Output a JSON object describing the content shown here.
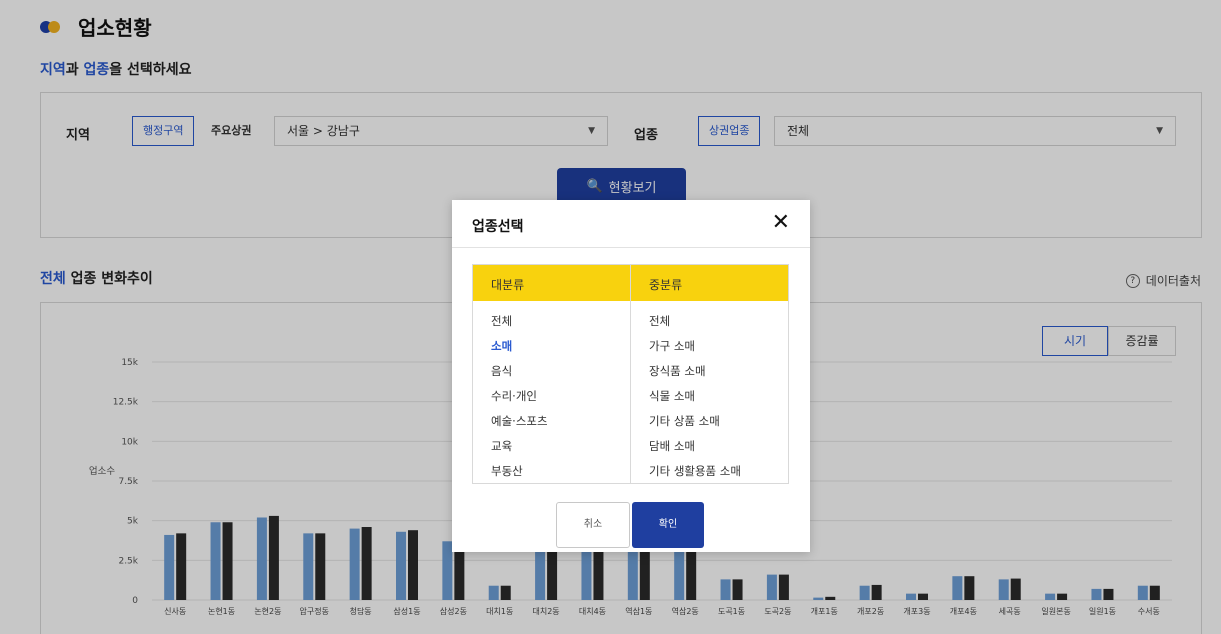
{
  "page": {
    "title": "업소현황",
    "instruction_part1": "지역",
    "instruction_part2": "과 ",
    "instruction_part3": "업종",
    "instruction_part4": "을 선택하세요"
  },
  "filter": {
    "region_label": "지역",
    "region_tab_admin": "행정구역",
    "region_tab_main": "주요상권",
    "region_value": "서울 > 강남구",
    "industry_label": "업종",
    "industry_tab": "상권업종",
    "industry_value": "전체",
    "view_button": "현황보기"
  },
  "section": {
    "title_highlight": "전체",
    "title_rest": " 업종 변화추이",
    "export_label": "데이터출처",
    "toggle_count": "시기",
    "toggle_rate": "증감률"
  },
  "chart_data": {
    "type": "bar",
    "ylabel": "업소수",
    "yticks": [
      "0",
      "2.5k",
      "5k",
      "7.5k",
      "10k",
      "12.5k",
      "15k"
    ],
    "ylim": [
      0,
      15000
    ],
    "categories": [
      "신사동",
      "논현1동",
      "논현2동",
      "압구정동",
      "청담동",
      "삼성1동",
      "삼성2동",
      "대치1동",
      "대치2동",
      "대치4동",
      "역삼1동",
      "역삼2동",
      "도곡1동",
      "도곡2동",
      "개포1동",
      "개포2동",
      "개포3동",
      "개포4동",
      "세곡동",
      "일원본동",
      "일원1동",
      "수서동"
    ],
    "series": [
      {
        "color": "#6d9fd8",
        "values": [
          4100,
          4900,
          5200,
          4200,
          4500,
          4300,
          3700,
          900,
          5000,
          5000,
          5000,
          5000,
          1300,
          1600,
          150,
          900,
          400,
          1500,
          1300,
          400,
          700,
          900
        ]
      },
      {
        "color": "#2b2b2b",
        "values": [
          4200,
          4900,
          5300,
          4200,
          4600,
          4400,
          3800,
          900,
          5100,
          5100,
          5100,
          5100,
          1300,
          1600,
          200,
          950,
          400,
          1500,
          1350,
          400,
          700,
          900
        ]
      }
    ],
    "grid": true
  },
  "modal": {
    "title": "업종선택",
    "col1_header": "대분류",
    "col2_header": "중분류",
    "col1_items": [
      "전체",
      "소매",
      "음식",
      "수리·개인",
      "예술·스포츠",
      "교육",
      "부동산"
    ],
    "col2_items": [
      "전체",
      "가구 소매",
      "장식품 소매",
      "식물 소매",
      "기타 상품 소매",
      "담배 소매",
      "기타 생활용품 소매"
    ],
    "selected_index": 1,
    "cancel_label": "취소",
    "ok_label": "확인"
  }
}
